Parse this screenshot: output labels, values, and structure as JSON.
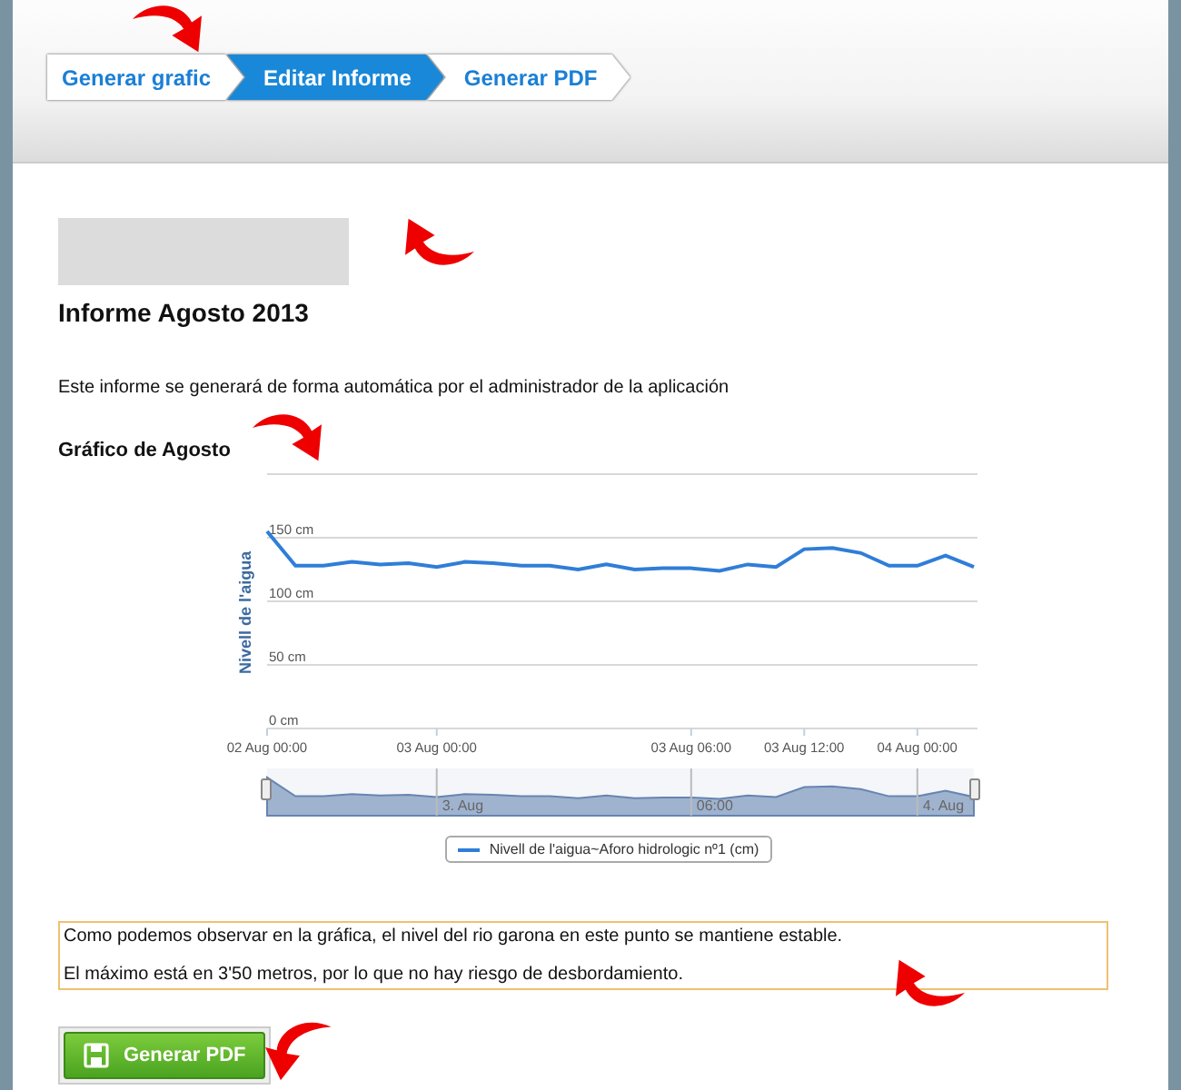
{
  "steps": [
    {
      "label": "Generar grafic",
      "selected": false
    },
    {
      "label": "Editar Informe",
      "selected": true
    },
    {
      "label": "Generar PDF",
      "selected": false
    }
  ],
  "report": {
    "title": "Informe Agosto 2013",
    "description": "Este informe se generará de forma automática por el administrador de la aplicación",
    "chart_heading": "Gráfico de Agosto",
    "chart_data": {
      "type": "line",
      "ylabel": "Nivell de l'aigua",
      "ylim": [
        0,
        200
      ],
      "grid": true,
      "yticks": [
        {
          "value": 0,
          "label": "0 cm"
        },
        {
          "value": 50,
          "label": "50 cm"
        },
        {
          "value": 100,
          "label": "100 cm"
        },
        {
          "value": 150,
          "label": "150 cm"
        }
      ],
      "categories": [
        "02 Aug 00:00",
        null,
        null,
        null,
        null,
        null,
        "03 Aug 00:00",
        null,
        null,
        null,
        null,
        null,
        null,
        null,
        null,
        "03 Aug 06:00",
        null,
        null,
        null,
        "03 Aug 12:00",
        null,
        null,
        null,
        "04 Aug 00:00",
        null,
        null
      ],
      "series": [
        {
          "name": "Nivell de l'aigua~Aforo hidrologic nº1 (cm)",
          "color": "#2f7ed8",
          "values": [
            155,
            128,
            128,
            131,
            129,
            130,
            127,
            131,
            130,
            128,
            128,
            125,
            129,
            125,
            126,
            126,
            124,
            129,
            127,
            141,
            142,
            138,
            128,
            128,
            136,
            127
          ]
        }
      ]
    },
    "navigator_labels": [
      "3. Aug",
      "06:00",
      "4. Aug"
    ]
  },
  "notes": [
    "Como podemos observar en la gráfica, el nivel del rio garona en este punto se mantiene estable.",
    "El máximo está en 3'50 metros, por lo que no hay riesgo de desbordamiento."
  ],
  "button": "Generar PDF"
}
